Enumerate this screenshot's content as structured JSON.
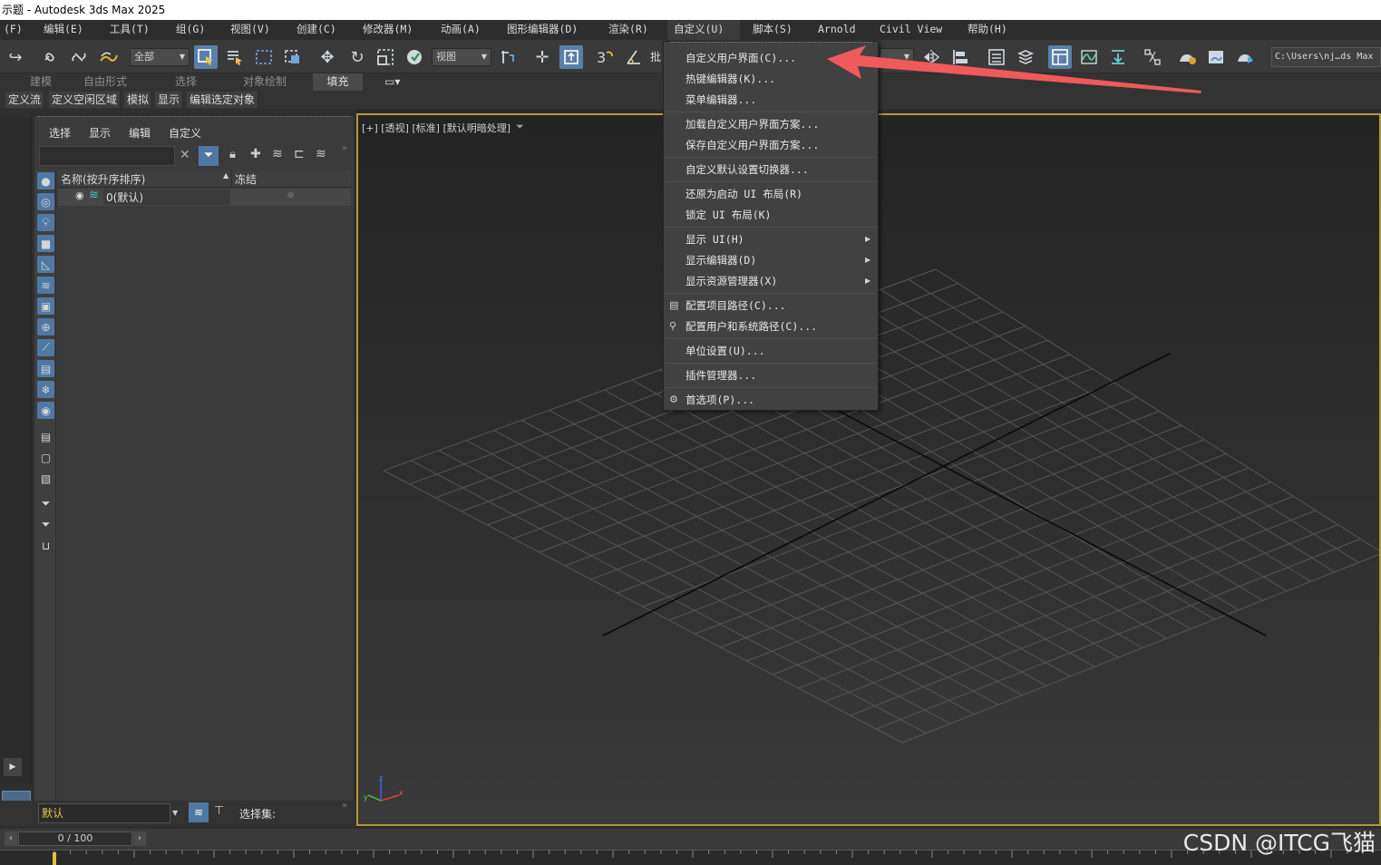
{
  "window": {
    "title": "示题 - Autodesk 3ds Max 2025"
  },
  "menubar": {
    "items": [
      "(F)",
      "编辑(E)",
      "工具(T)",
      "组(G)",
      "视图(V)",
      "创建(C)",
      "修改器(M)",
      "动画(A)",
      "图形编辑器(D)",
      "渲染(R)",
      "自定义(U)",
      "脚本(S)",
      "Arnold",
      "Civil View",
      "帮助(H)"
    ],
    "active": "自定义(U)"
  },
  "toolbar": {
    "selection_filter": "全部",
    "ref_coord": "视图",
    "batch_label": "批",
    "project_path": "C:\\Users\\nj…ds Max"
  },
  "ribbon": {
    "tabs": [
      "建模",
      "自由形式",
      "选择",
      "对象绘制",
      "填充"
    ],
    "selected": "填充",
    "buttons": [
      "定义流",
      "定义空闲区域",
      "模拟",
      "显示",
      "编辑选定对象"
    ]
  },
  "scene_explorer": {
    "menu": [
      "选择",
      "显示",
      "编辑",
      "自定义"
    ],
    "column_name": "名称(按升序排序)",
    "column_frozen": "冻结",
    "rows": [
      {
        "name": "0(默认)"
      }
    ],
    "layer": "默认",
    "selection_set_label": "选择集:"
  },
  "viewport": {
    "label": "[+] [透视] [标准] [默认明暗处理]"
  },
  "dropdown": {
    "items": [
      {
        "label": "自定义用户界面(C)...",
        "group": 1
      },
      {
        "label": "热键编辑器(K)...",
        "group": 1
      },
      {
        "label": "菜单编辑器...",
        "group": 1
      },
      {
        "label": "加载自定义用户界面方案...",
        "group": 2
      },
      {
        "label": "保存自定义用户界面方案...",
        "group": 2
      },
      {
        "label": "自定义默认设置切换器...",
        "group": 3
      },
      {
        "label": "还原为启动 UI 布局(R)",
        "group": 4
      },
      {
        "label": "锁定 UI 布局(K)",
        "group": 4
      },
      {
        "label": "显示 UI(H)",
        "group": 5,
        "submenu": true
      },
      {
        "label": "显示编辑器(D)",
        "group": 5,
        "submenu": true
      },
      {
        "label": "显示资源管理器(X)",
        "group": 5,
        "submenu": true
      },
      {
        "label": "配置项目路径(C)...",
        "group": 6,
        "icon": "folder-gear-icon"
      },
      {
        "label": "配置用户和系统路径(C)...",
        "group": 6,
        "icon": "user-gear-icon"
      },
      {
        "label": "单位设置(U)...",
        "group": 7
      },
      {
        "label": "插件管理器...",
        "group": 8
      },
      {
        "label": "首选项(P)...",
        "group": 9,
        "icon": "gear-icon"
      }
    ]
  },
  "timeline": {
    "frame": "0 / 100"
  },
  "watermark": "CSDN @ITCG飞猫",
  "colors": {
    "accent": "#5a7fa8",
    "viewport_border": "#b09a3e",
    "annotation_arrow": "#f05a5a"
  }
}
